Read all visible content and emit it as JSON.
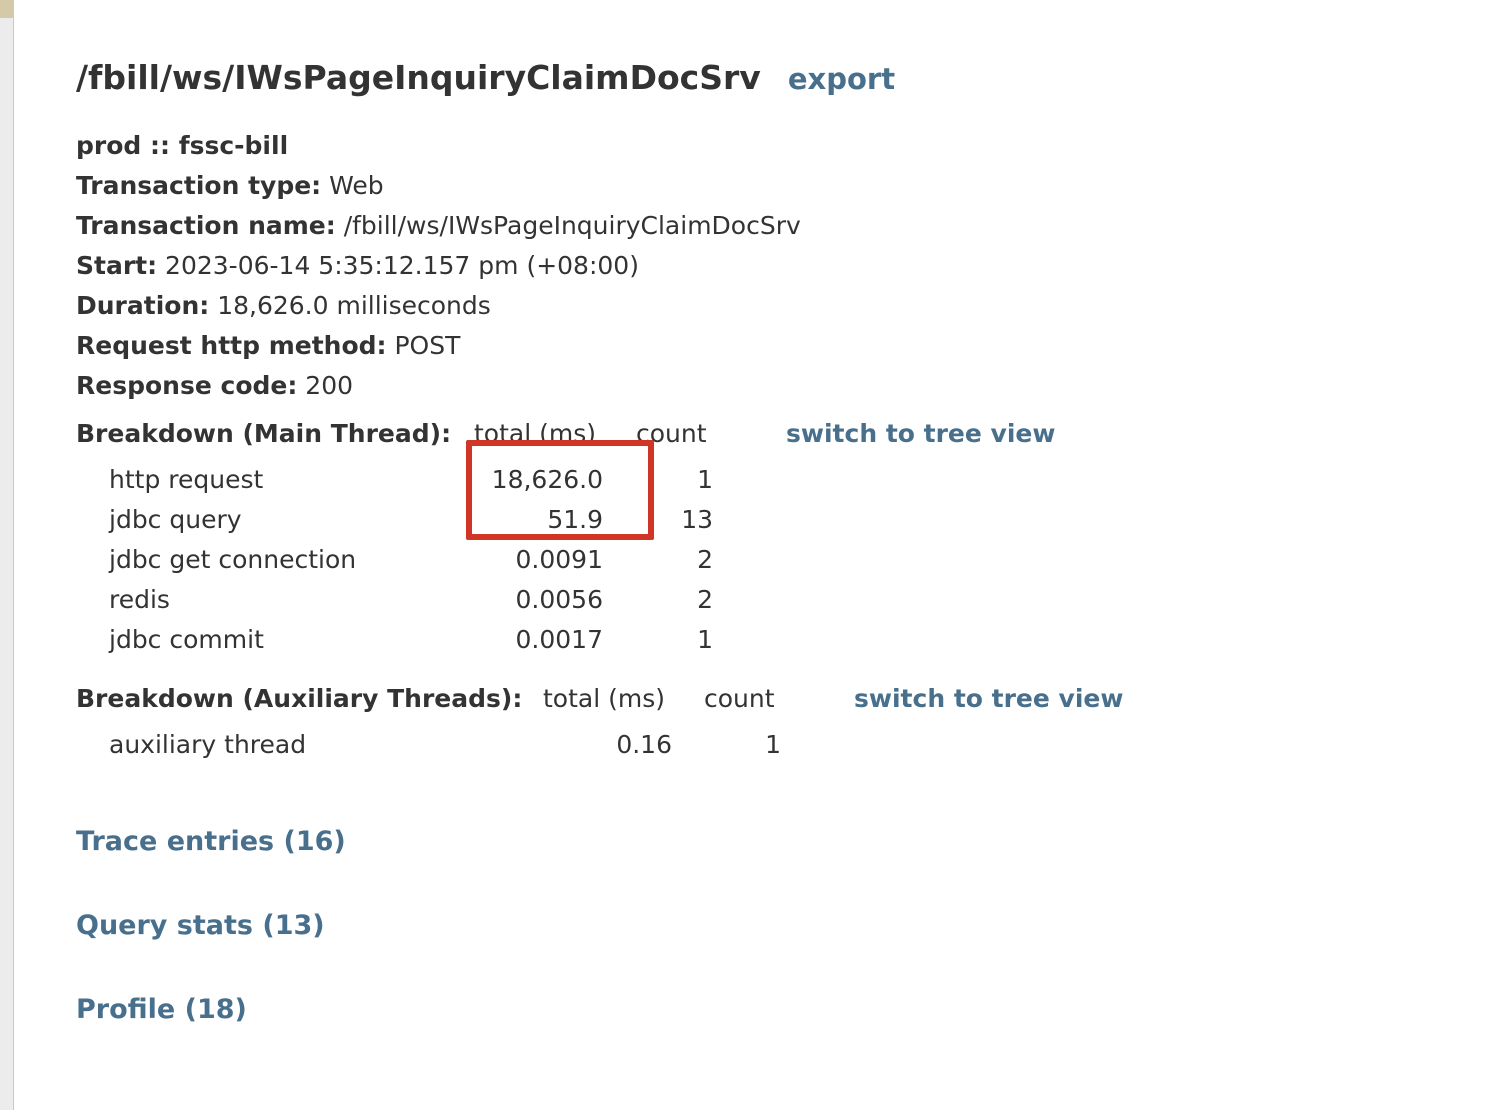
{
  "title": "/fbill/ws/IWsPageInquiryClaimDocSrv",
  "export_label": "export",
  "env_line": "prod :: fssc-bill",
  "fields": [
    {
      "label": "Transaction type:",
      "value": " Web"
    },
    {
      "label": "Transaction name:",
      "value": " /fbill/ws/IWsPageInquiryClaimDocSrv"
    },
    {
      "label": "Start:",
      "value": " 2023-06-14 5:35:12.157 pm (+08:00)"
    },
    {
      "label": "Duration:",
      "value": " 18,626.0 milliseconds"
    },
    {
      "label": "Request http method:",
      "value": " POST"
    },
    {
      "label": "Response code:",
      "value": " 200"
    }
  ],
  "main_breakdown": {
    "label": "Breakdown (Main Thread):",
    "total_header": "total (ms)",
    "count_header": "count",
    "tree_link": "switch to tree view",
    "rows": [
      {
        "name": "http request",
        "total": "18,626.0",
        "count": "1"
      },
      {
        "name": "jdbc query",
        "total": "51.9",
        "count": "13"
      },
      {
        "name": "jdbc get connection",
        "total": "0.0091",
        "count": "2"
      },
      {
        "name": "redis",
        "total": "0.0056",
        "count": "2"
      },
      {
        "name": "jdbc commit",
        "total": "0.0017",
        "count": "1"
      }
    ]
  },
  "aux_breakdown": {
    "label": "Breakdown (Auxiliary Threads):",
    "total_header": "total (ms)",
    "count_header": "count",
    "tree_link": "switch to tree view",
    "rows": [
      {
        "name": "auxiliary thread",
        "total": "0.16",
        "count": "1"
      }
    ]
  },
  "sections": {
    "trace_entries": "Trace entries (16)",
    "query_stats": "Query stats (13)",
    "profile": "Profile (18)"
  },
  "colors": {
    "link": "#486f8c",
    "highlight_box": "#d03526",
    "text": "#333333"
  }
}
